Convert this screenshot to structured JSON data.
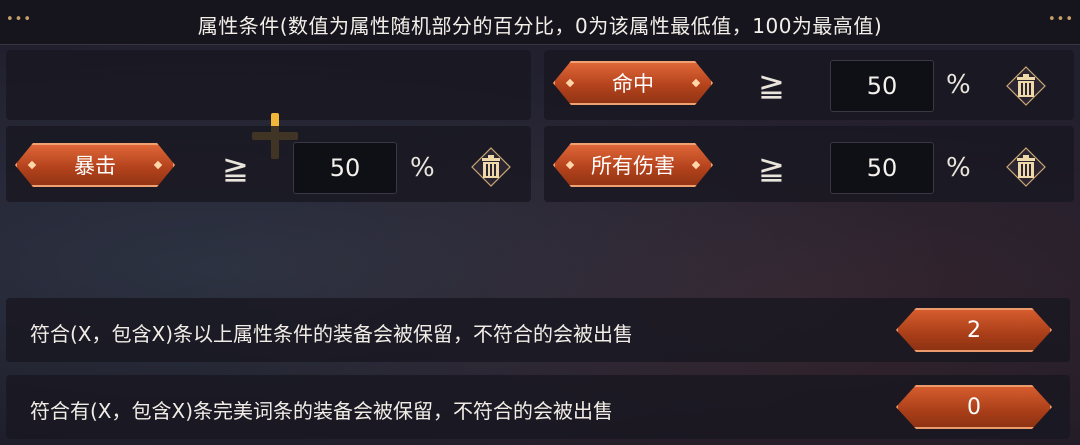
{
  "header": {
    "title": "属性条件(数值为属性随机部分的百分比，0为该属性最低值，100为最高值)",
    "dots": "•••"
  },
  "conditions": [
    {
      "attr": "命中",
      "op": "≧",
      "value": "50",
      "unit": "%"
    },
    {
      "attr": "暴击",
      "op": "≧",
      "value": "50",
      "unit": "%"
    },
    {
      "attr": "所有伤害",
      "op": "≧",
      "value": "50",
      "unit": "%"
    }
  ],
  "rules": [
    {
      "text": "符合(X，包含X)条以上属性条件的装备会被保留，不符合的会被出售",
      "value": "2"
    },
    {
      "text": "符合有(X，包含X)条完美词条的装备会被保留，不符合的会被出售",
      "value": "0"
    }
  ],
  "icons": {
    "add": "plus-icon",
    "delete": "trash-icon"
  },
  "colors": {
    "accent": "#d95f30",
    "gold": "#f0b43a",
    "panel": "#181721"
  }
}
